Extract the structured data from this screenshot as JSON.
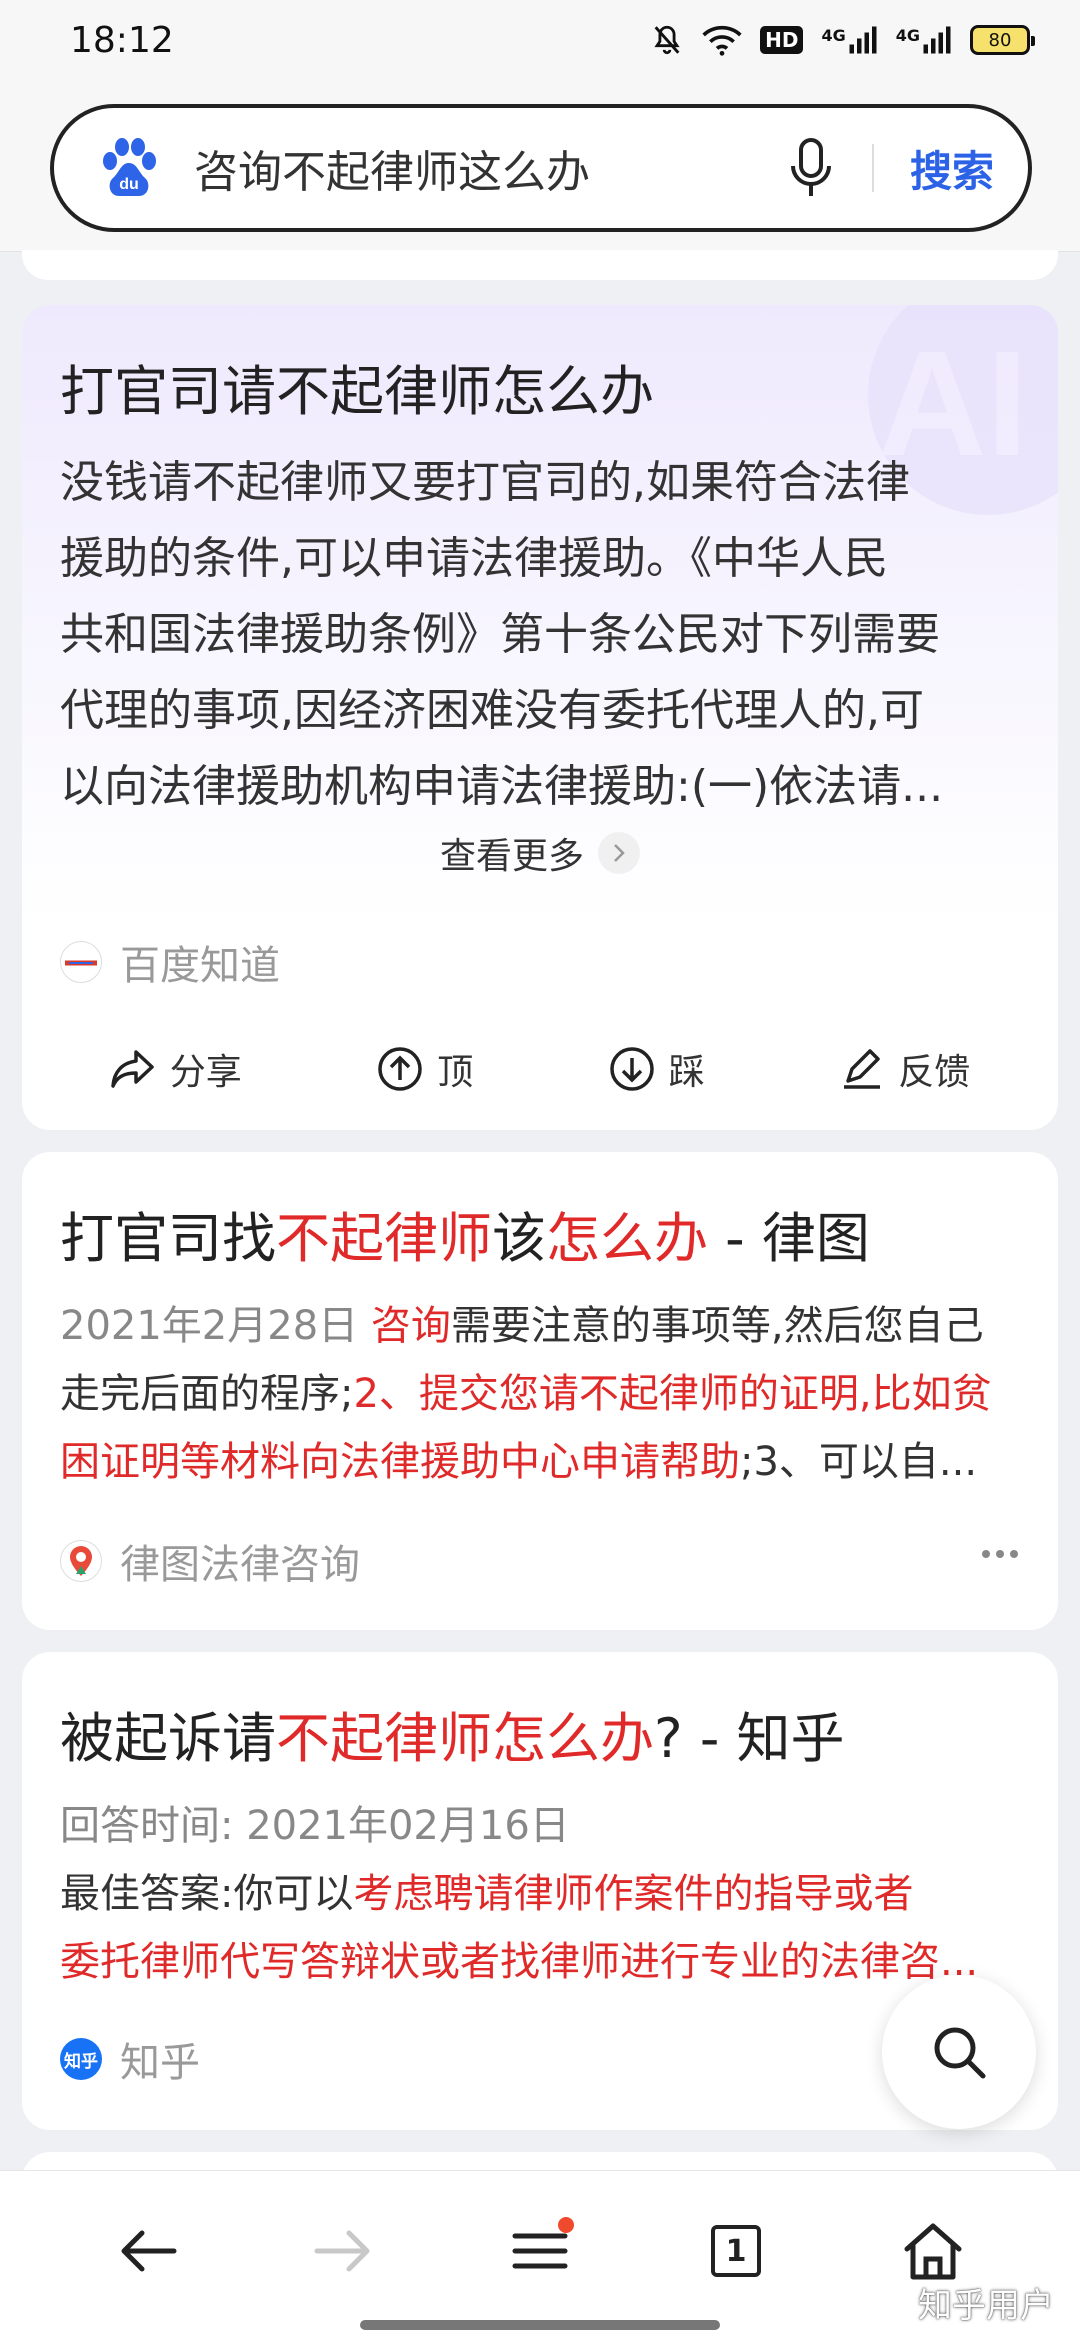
{
  "status_bar": {
    "time": "18:12",
    "hd_label": "HD",
    "net1": "4G",
    "net2": "4G",
    "battery": "80"
  },
  "search": {
    "query": "咨询不起律师这么办",
    "button": "搜索"
  },
  "ai_card": {
    "title": "打官司请不起律师怎么办",
    "lines": [
      "没钱请不起律师又要打官司的,如果符合法律",
      "援助的条件,可以申请法律援助。《中华人民",
      "共和国法律援助条例》第十条公民对下列需要",
      "代理的事项,因经济困难没有委托代理人的,可",
      "以向法律援助机构申请法律援助:(一)依法请..."
    ],
    "view_more": "查看更多",
    "source": "百度知道",
    "actions": {
      "share": "分享",
      "up": "顶",
      "down": "踩",
      "feedback": "反馈"
    }
  },
  "result1": {
    "title_parts": [
      "打官司找",
      "不起律师",
      "该",
      "怎么办",
      " - 律图"
    ],
    "date": "2021年2月28日",
    "line1_red": "咨询",
    "line1_rest": "需要注意的事项等,然后您自己",
    "line2_normal": "走完后面的程序;",
    "line2_red": "2、提交您请不起律师的证明,比如贫",
    "line3_red": "困证明等材料向法律援助中心申请帮助",
    "line3_rest": ";3、可以自...",
    "source": "律图法律咨询"
  },
  "result2": {
    "title_parts": [
      "被起诉请",
      "不起律师怎么办",
      "? - 知乎"
    ],
    "answer_time": "回答时间: 2021年02月16日",
    "line2_label": "最佳答案:你可以",
    "line2_red": "考虑聘请律师作案件的指导或者",
    "line3_red": "委托律师代写答辩状或者找律师进行专业的法律咨...",
    "source": "知乎",
    "source_icon_text": "知乎"
  },
  "watermark": "知乎用户",
  "colors": {
    "accent_blue": "#2b62e6",
    "highlight_red": "#e02a2a",
    "notification_dot": "#f04a2e"
  }
}
